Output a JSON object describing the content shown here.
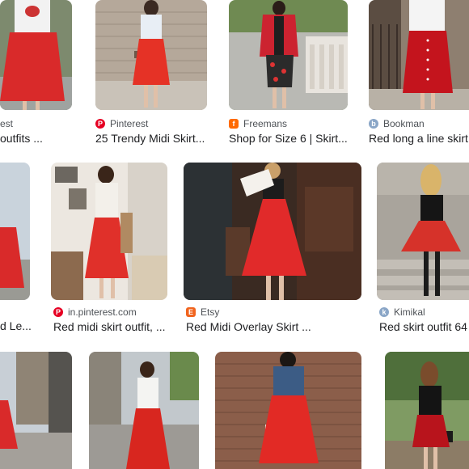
{
  "colors": {
    "pinterest": "#e60023",
    "freemans": "#ff6a00",
    "etsy": "#f1641e",
    "generic": "#8aa6c7",
    "skirt_red": "#d92a2a"
  },
  "row1": {
    "col0": {
      "source": "est",
      "title": "outfits ..."
    },
    "col1": {
      "source": "Pinterest",
      "title": "25 Trendy Midi Skirt..."
    },
    "col2": {
      "source": "Freemans",
      "title": "Shop for Size 6 | Skirt..."
    },
    "col3": {
      "source": "Bookman",
      "title": "Red long a line skirt"
    }
  },
  "row2": {
    "col0": {
      "title": "d Le..."
    },
    "col1": {
      "source": "in.pinterest.com",
      "title": "Red midi skirt outfit, ..."
    },
    "col2": {
      "source": "Etsy",
      "title": "Red Midi Overlay Skirt ..."
    },
    "col3": {
      "source": "Kimikal",
      "title": "Red skirt outfit 64"
    }
  }
}
